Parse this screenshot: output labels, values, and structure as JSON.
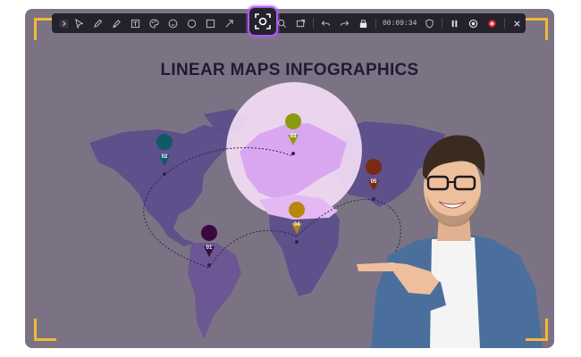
{
  "toolbar": {
    "items": [
      {
        "name": "collapse-icon"
      },
      {
        "name": "pointer-icon"
      },
      {
        "name": "pen-icon"
      },
      {
        "name": "highlighter-icon"
      },
      {
        "name": "text-box-icon"
      },
      {
        "name": "color-palette-icon"
      },
      {
        "name": "emoji-icon"
      },
      {
        "name": "circle-icon"
      },
      {
        "name": "rectangle-icon"
      },
      {
        "name": "arrow-icon"
      },
      {
        "name": "screenshot-icon"
      },
      {
        "name": "search-icon"
      },
      {
        "name": "screen-capture-icon"
      },
      {
        "name": "undo-icon"
      },
      {
        "name": "redo-icon"
      },
      {
        "name": "clear-icon"
      }
    ],
    "timer": "00:09:34",
    "pause_icon": "pause-icon",
    "record_icon": "record-icon",
    "stop_icon": "stop-record-icon",
    "close_icon": "close-icon",
    "highlight_color": "#a560e8",
    "background_color": "#24222c"
  },
  "slide": {
    "title": "LINEAR MAPS INFOGRAPHICS",
    "markers": [
      {
        "label": "01",
        "color": "#3a0a3e"
      },
      {
        "label": "02",
        "color": "#0f5a66"
      },
      {
        "label": "03",
        "color": "#8a9b12"
      },
      {
        "label": "04",
        "color": "#b8860b"
      },
      {
        "label": "05",
        "color": "#7a2a12"
      }
    ],
    "map_color": "#5a4d8c",
    "magnifier_color": "#f3ddf6"
  },
  "frame": {
    "corner_color": "#f3b83a"
  }
}
